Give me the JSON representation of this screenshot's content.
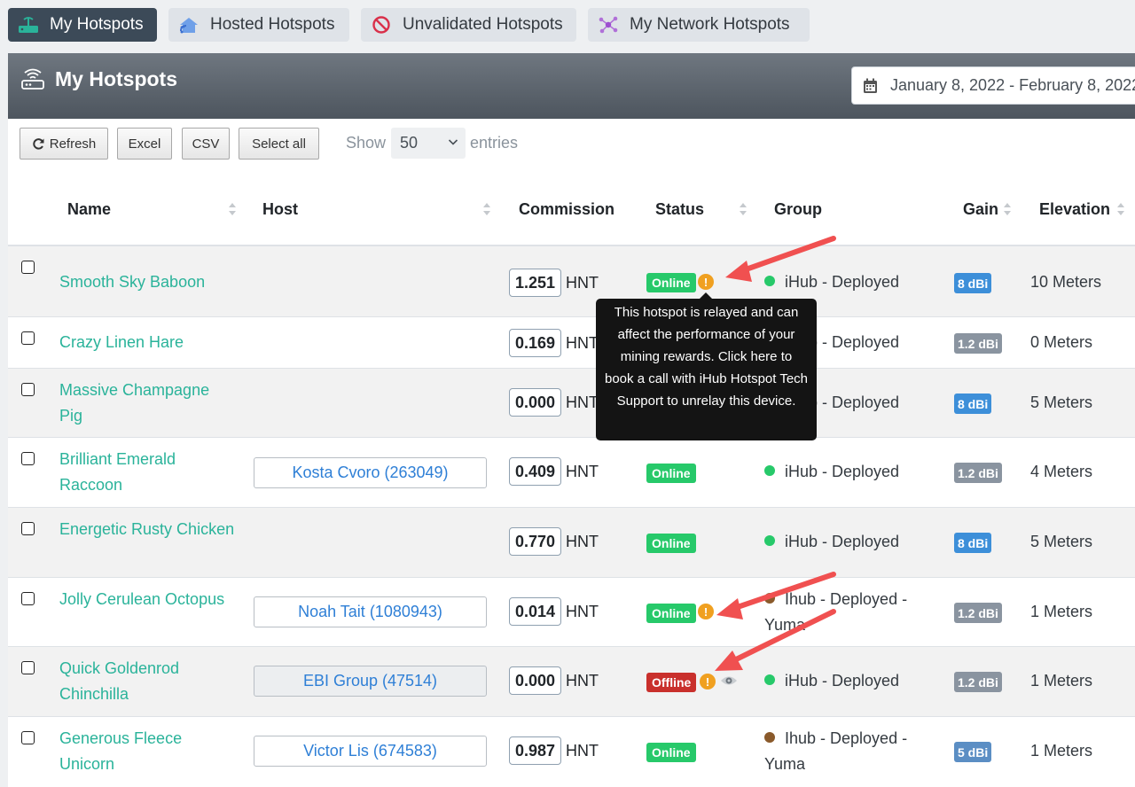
{
  "nav": {
    "tabs": [
      {
        "label": "My Hotspots",
        "icon": "router-icon",
        "active": true
      },
      {
        "label": "Hosted Hotspots",
        "icon": "wifi-home-icon",
        "active": false
      },
      {
        "label": "Unvalidated Hotspots",
        "icon": "ban-icon",
        "active": false
      },
      {
        "label": "My Network Hotspots",
        "icon": "network-icon",
        "active": false
      }
    ]
  },
  "card": {
    "title": "My Hotspots",
    "date_range": "January 8, 2022 - February 8, 2022"
  },
  "toolbar": {
    "refresh": "Refresh",
    "excel": "Excel",
    "csv": "CSV",
    "select_all": "Select all",
    "show": "Show",
    "entries_value": "50",
    "entries": "entries"
  },
  "columns": [
    "Name",
    "Host",
    "Commission",
    "Status",
    "Group",
    "Gain",
    "Elevation"
  ],
  "rows": [
    {
      "name": "Smooth Sky Baboon",
      "host": "",
      "commission": "1.251",
      "unit": "HNT",
      "status": "Online",
      "warn": "!",
      "group": "iHub - Deployed",
      "gain": "8 dBi",
      "elevation": "10 Meters"
    },
    {
      "name": "Crazy Linen Hare",
      "host": "",
      "commission": "0.169",
      "unit": "HNT",
      "status": "",
      "warn": "",
      "group": "iHub - Deployed",
      "gain": "1.2 dBi",
      "elevation": "0 Meters"
    },
    {
      "name": "Massive Champagne Pig",
      "host": "",
      "commission": "0.000",
      "unit": "HNT",
      "status": "",
      "warn": "",
      "group": "iHub - Deployed",
      "gain": "8 dBi",
      "elevation": "5 Meters"
    },
    {
      "name": "Brilliant Emerald Raccoon",
      "host": "Kosta Cvoro (263049)",
      "commission": "0.409",
      "unit": "HNT",
      "status": "Online",
      "warn": "",
      "group": "iHub - Deployed",
      "gain": "1.2 dBi",
      "elevation": "4 Meters"
    },
    {
      "name": "Energetic Rusty Chicken",
      "host": "",
      "commission": "0.770",
      "unit": "HNT",
      "status": "Online",
      "warn": "",
      "group": "iHub - Deployed",
      "gain": "8 dBi",
      "elevation": "5 Meters"
    },
    {
      "name": "Jolly Cerulean Octopus",
      "host": "Noah Tait (1080943)",
      "commission": "0.014",
      "unit": "HNT",
      "status": "Online",
      "warn": "!",
      "group": "Ihub - Deployed - Yuma",
      "gain": "1.2 dBi",
      "elevation": "1 Meters"
    },
    {
      "name": "Quick Goldenrod Chinchilla",
      "host": "EBI Group (47514)",
      "commission": "0.000",
      "unit": "HNT",
      "status": "Offline",
      "warn": "!",
      "group": "iHub - Deployed",
      "gain": "1.2 dBi",
      "elevation": "1 Meters"
    },
    {
      "name": "Generous Fleece Unicorn",
      "host": "Victor Lis (674583)",
      "commission": "0.987",
      "unit": "HNT",
      "status": "Online",
      "warn": "",
      "group": "Ihub - Deployed - Yuma",
      "gain": "5 dBi",
      "elevation": "1 Meters"
    }
  ],
  "tooltip": {
    "text": "This hotspot is relayed and can affect the performance of your mining rewards. Click here to book a call with iHub Hotspot Tech Support to unrelay this device."
  },
  "colors": {
    "accent_teal": "#2ab39a",
    "online": "#27c96a",
    "offline": "#c9302c",
    "warning": "#f0a020",
    "arrow": "#f05050",
    "group_green": "#27c96a",
    "group_brown": "#8a5a2b"
  }
}
